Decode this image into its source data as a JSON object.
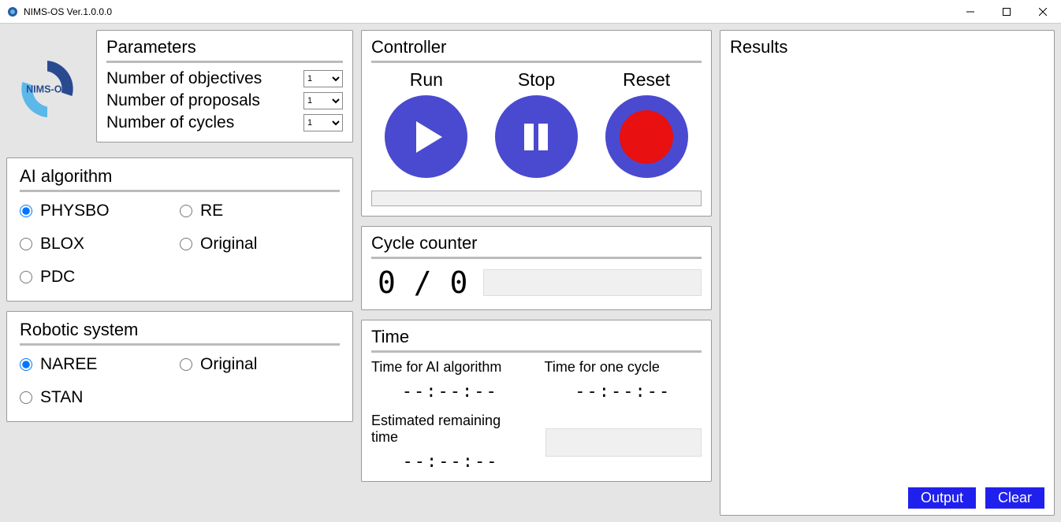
{
  "titlebar": {
    "title": "NIMS-OS   Ver.1.0.0.0"
  },
  "parameters": {
    "header": "Parameters",
    "rows": [
      {
        "label": "Number of objectives",
        "value": "1"
      },
      {
        "label": "Number of proposals",
        "value": "1"
      },
      {
        "label": "Number of cycles",
        "value": "1"
      }
    ]
  },
  "ai_algorithm": {
    "header": "AI algorithm",
    "options": [
      "PHYSBO",
      "RE",
      "BLOX",
      "Original",
      "PDC"
    ],
    "selected": "PHYSBO"
  },
  "robotic_system": {
    "header": "Robotic system",
    "options": [
      "NAREE",
      "Original",
      "STAN"
    ],
    "selected": "NAREE"
  },
  "controller": {
    "header": "Controller",
    "run": "Run",
    "stop": "Stop",
    "reset": "Reset"
  },
  "cycle_counter": {
    "header": "Cycle counter",
    "value": "0 / 0"
  },
  "time": {
    "header": "Time",
    "ai_label": "Time for AI algorithm",
    "ai_value": "--:--:--",
    "cycle_label": "Time for one cycle",
    "cycle_value": "--:--:--",
    "remain_label": "Estimated remaining time",
    "remain_value": "--:--:--"
  },
  "results": {
    "header": "Results",
    "output_btn": "Output",
    "clear_btn": "Clear"
  }
}
